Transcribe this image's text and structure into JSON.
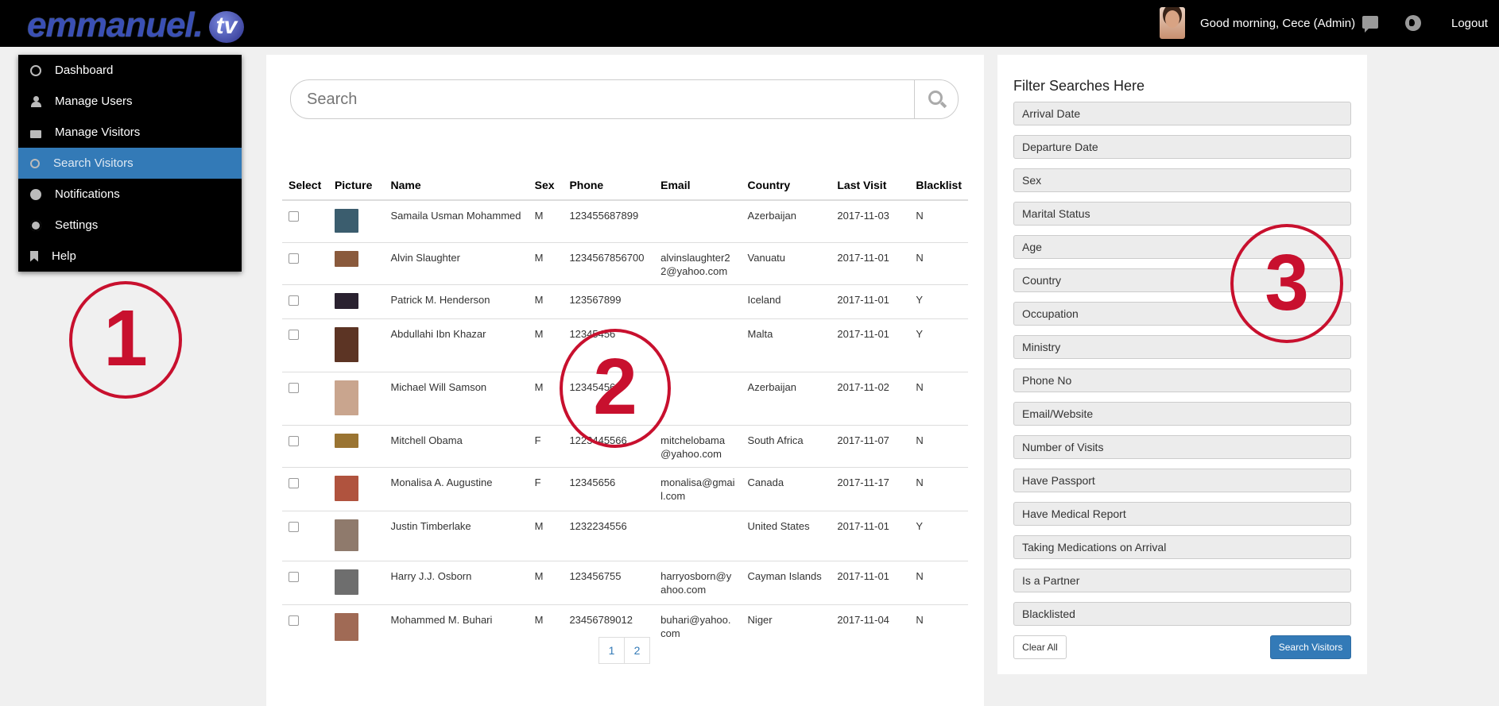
{
  "brand": {
    "logo_text": "emmanuel.",
    "logo_badge": "tv"
  },
  "header": {
    "greeting": "Good morning, Cece (Admin)",
    "logout": "Logout",
    "icons": [
      "chat-icon",
      "globe-icon"
    ]
  },
  "sidebar": {
    "items": [
      {
        "label": "Dashboard",
        "icon": "dashboard-icon"
      },
      {
        "label": "Manage Users",
        "icon": "user-icon"
      },
      {
        "label": "Manage Visitors",
        "icon": "folder-icon"
      },
      {
        "label": "Search Visitors",
        "icon": "search-icon",
        "active": true
      },
      {
        "label": "Notifications",
        "icon": "globe-icon"
      },
      {
        "label": "Settings",
        "icon": "gear-icon"
      },
      {
        "label": "Help",
        "icon": "bookmark-icon"
      }
    ]
  },
  "annotations": [
    "1",
    "2",
    "3"
  ],
  "search": {
    "placeholder": "Search"
  },
  "table": {
    "headers": [
      "Select",
      "Picture",
      "Name",
      "Sex",
      "Phone",
      "Email",
      "Country",
      "Last Visit",
      "Blacklist"
    ],
    "rows": [
      {
        "name": "Samaila Usman Mohammed",
        "sex": "M",
        "phone": "123455687899",
        "email": "",
        "country": "Azerbaijan",
        "last_visit": "2017-11-03",
        "blacklist": "N"
      },
      {
        "name": "Alvin Slaughter",
        "sex": "M",
        "phone": "1234567856700",
        "email": "alvinslaughter2\n2@yahoo.com",
        "country": "Vanuatu",
        "last_visit": "2017-11-01",
        "blacklist": "N"
      },
      {
        "name": "Patrick M. Henderson",
        "sex": "M",
        "phone": "123567899",
        "email": "",
        "country": "Iceland",
        "last_visit": "2017-11-01",
        "blacklist": "Y"
      },
      {
        "name": "Abdullahi Ibn Khazar",
        "sex": "M",
        "phone": "12345456",
        "email": "",
        "country": "Malta",
        "last_visit": "2017-11-01",
        "blacklist": "Y"
      },
      {
        "name": "Michael Will Samson",
        "sex": "M",
        "phone": "12345456",
        "email": "",
        "country": "Azerbaijan",
        "last_visit": "2017-11-02",
        "blacklist": "N"
      },
      {
        "name": "Mitchell Obama",
        "sex": "F",
        "phone": "1223445566",
        "email": "mitchelobama\n@yahoo.com",
        "country": "South Africa",
        "last_visit": "2017-11-07",
        "blacklist": "N"
      },
      {
        "name": "Monalisa A. Augustine",
        "sex": "F",
        "phone": "12345656",
        "email": "monalisa@gmai\nl.com",
        "country": "Canada",
        "last_visit": "2017-11-17",
        "blacklist": "N"
      },
      {
        "name": "Justin Timberlake",
        "sex": "M",
        "phone": "1232234556",
        "email": "",
        "country": "United States",
        "last_visit": "2017-11-01",
        "blacklist": "Y"
      },
      {
        "name": "Harry J.J. Osborn",
        "sex": "M",
        "phone": "123456755",
        "email": "harryosborn@y\nahoo.com",
        "country": "Cayman Islands",
        "last_visit": "2017-11-01",
        "blacklist": "N"
      },
      {
        "name": "Mohammed M. Buhari",
        "sex": "M",
        "phone": "23456789012",
        "email": "buhari@yahoo.\ncom",
        "country": "Niger",
        "last_visit": "2017-11-04",
        "blacklist": "N"
      }
    ]
  },
  "pagination": [
    "1",
    "2"
  ],
  "filter": {
    "title": "Filter Searches Here",
    "options": [
      "Arrival Date",
      "Departure Date",
      "Sex",
      "Marital Status",
      "Age",
      "Country",
      "Occupation",
      "Ministry",
      "Phone No",
      "Email/Website",
      "Number of Visits",
      "Have Passport",
      "Have Medical Report",
      "Taking Medications on Arrival",
      "Is a Partner",
      "Blacklisted"
    ],
    "clear_label": "Clear All",
    "search_label": "Search Visitors"
  }
}
